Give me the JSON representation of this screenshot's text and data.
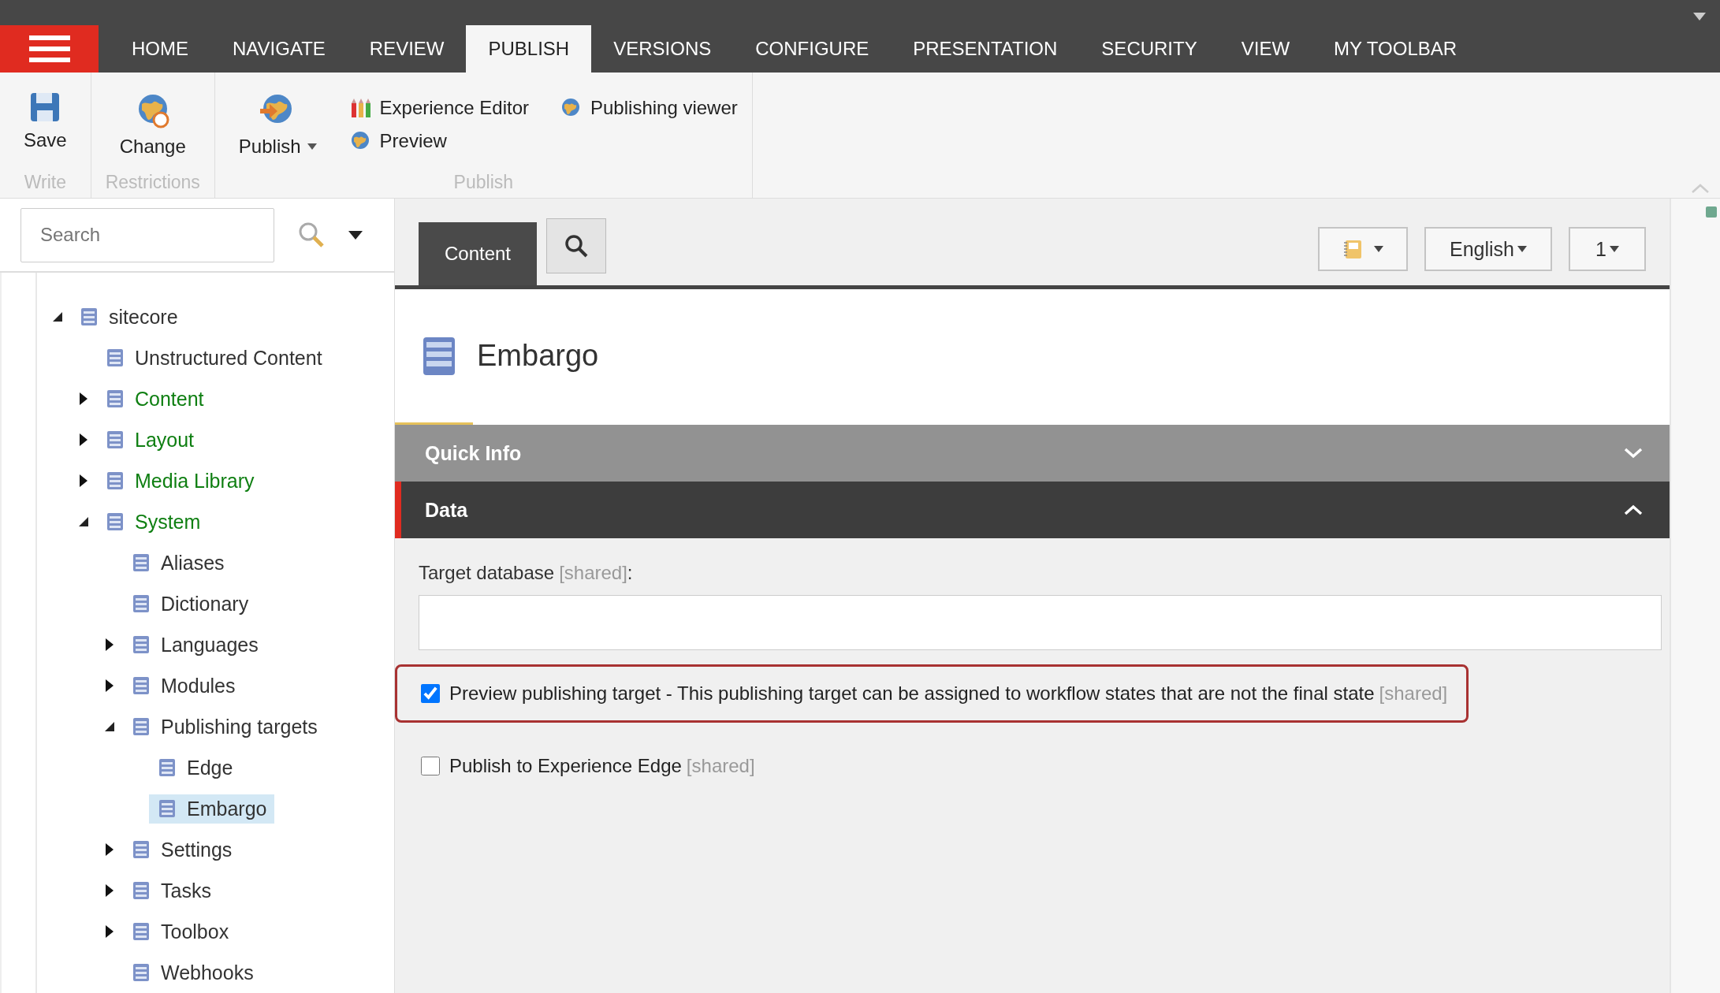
{
  "menu_tabs": [
    {
      "label": "HOME",
      "selected": false
    },
    {
      "label": "NAVIGATE",
      "selected": false
    },
    {
      "label": "REVIEW",
      "selected": false
    },
    {
      "label": "PUBLISH",
      "selected": true
    },
    {
      "label": "VERSIONS",
      "selected": false
    },
    {
      "label": "CONFIGURE",
      "selected": false
    },
    {
      "label": "PRESENTATION",
      "selected": false
    },
    {
      "label": "SECURITY",
      "selected": false
    },
    {
      "label": "VIEW",
      "selected": false
    },
    {
      "label": "MY TOOLBAR",
      "selected": false
    }
  ],
  "ribbon": {
    "groups": [
      {
        "label": "Write",
        "buttons": [
          {
            "label": "Save",
            "kind": "large"
          }
        ]
      },
      {
        "label": "Restrictions",
        "buttons": [
          {
            "label": "Change",
            "kind": "large"
          }
        ]
      },
      {
        "label": "Publish",
        "buttons": [
          {
            "label": "Publish",
            "kind": "large",
            "dropdown": true
          },
          {
            "label": "Experience Editor",
            "kind": "small"
          },
          {
            "label": "Preview",
            "kind": "small"
          },
          {
            "label": "Publishing viewer",
            "kind": "small"
          }
        ]
      }
    ]
  },
  "search": {
    "placeholder": "Search"
  },
  "tree": [
    {
      "label": "sitecore",
      "color": "#333333",
      "selected": false,
      "expanded": true,
      "children": [
        {
          "label": "Unstructured Content",
          "color": "#333333",
          "selected": false
        },
        {
          "label": "Content",
          "color": "#0f7f12",
          "selected": false,
          "expanded": false
        },
        {
          "label": "Layout",
          "color": "#0f7f12",
          "selected": false,
          "expanded": false
        },
        {
          "label": "Media Library",
          "color": "#0f7f12",
          "selected": false,
          "expanded": false
        },
        {
          "label": "System",
          "color": "#0f7f12",
          "selected": false,
          "expanded": true,
          "children": [
            {
              "label": "Aliases",
              "color": "#333333",
              "selected": false
            },
            {
              "label": "Dictionary",
              "color": "#333333",
              "selected": false
            },
            {
              "label": "Languages",
              "color": "#333333",
              "selected": false,
              "expanded": false
            },
            {
              "label": "Modules",
              "color": "#333333",
              "selected": false,
              "expanded": false
            },
            {
              "label": "Publishing targets",
              "color": "#333333",
              "selected": false,
              "expanded": true,
              "children": [
                {
                  "label": "Edge",
                  "color": "#333333",
                  "selected": false
                },
                {
                  "label": "Embargo",
                  "color": "#333333",
                  "selected": true
                }
              ]
            },
            {
              "label": "Settings",
              "color": "#333333",
              "selected": false,
              "expanded": false
            },
            {
              "label": "Tasks",
              "color": "#333333",
              "selected": false,
              "expanded": false
            },
            {
              "label": "Toolbox",
              "color": "#333333",
              "selected": false,
              "expanded": false
            },
            {
              "label": "Webhooks",
              "color": "#333333",
              "selected": false
            }
          ]
        }
      ]
    }
  ],
  "editor_tabs": [
    {
      "label": "Content",
      "kind": "text",
      "selected": true
    },
    {
      "kind": "search",
      "selected": false
    }
  ],
  "toolbar": {
    "language": "English",
    "version": "1"
  },
  "item": {
    "title": "Embargo"
  },
  "sections": [
    {
      "title": "Quick Info",
      "expanded": false
    },
    {
      "title": "Data",
      "expanded": true
    }
  ],
  "fields": [
    {
      "kind": "text",
      "label": "Target database",
      "shared": "[shared]",
      "suffix": ":"
    },
    {
      "kind": "checkbox",
      "label": "Preview publishing target - This publishing target can be assigned to workflow states that are not the final state",
      "shared": "[shared]",
      "checked": true,
      "focused": true
    },
    {
      "kind": "checkbox",
      "label": "Publish to Experience Edge",
      "shared": "[shared]",
      "checked": false
    }
  ]
}
